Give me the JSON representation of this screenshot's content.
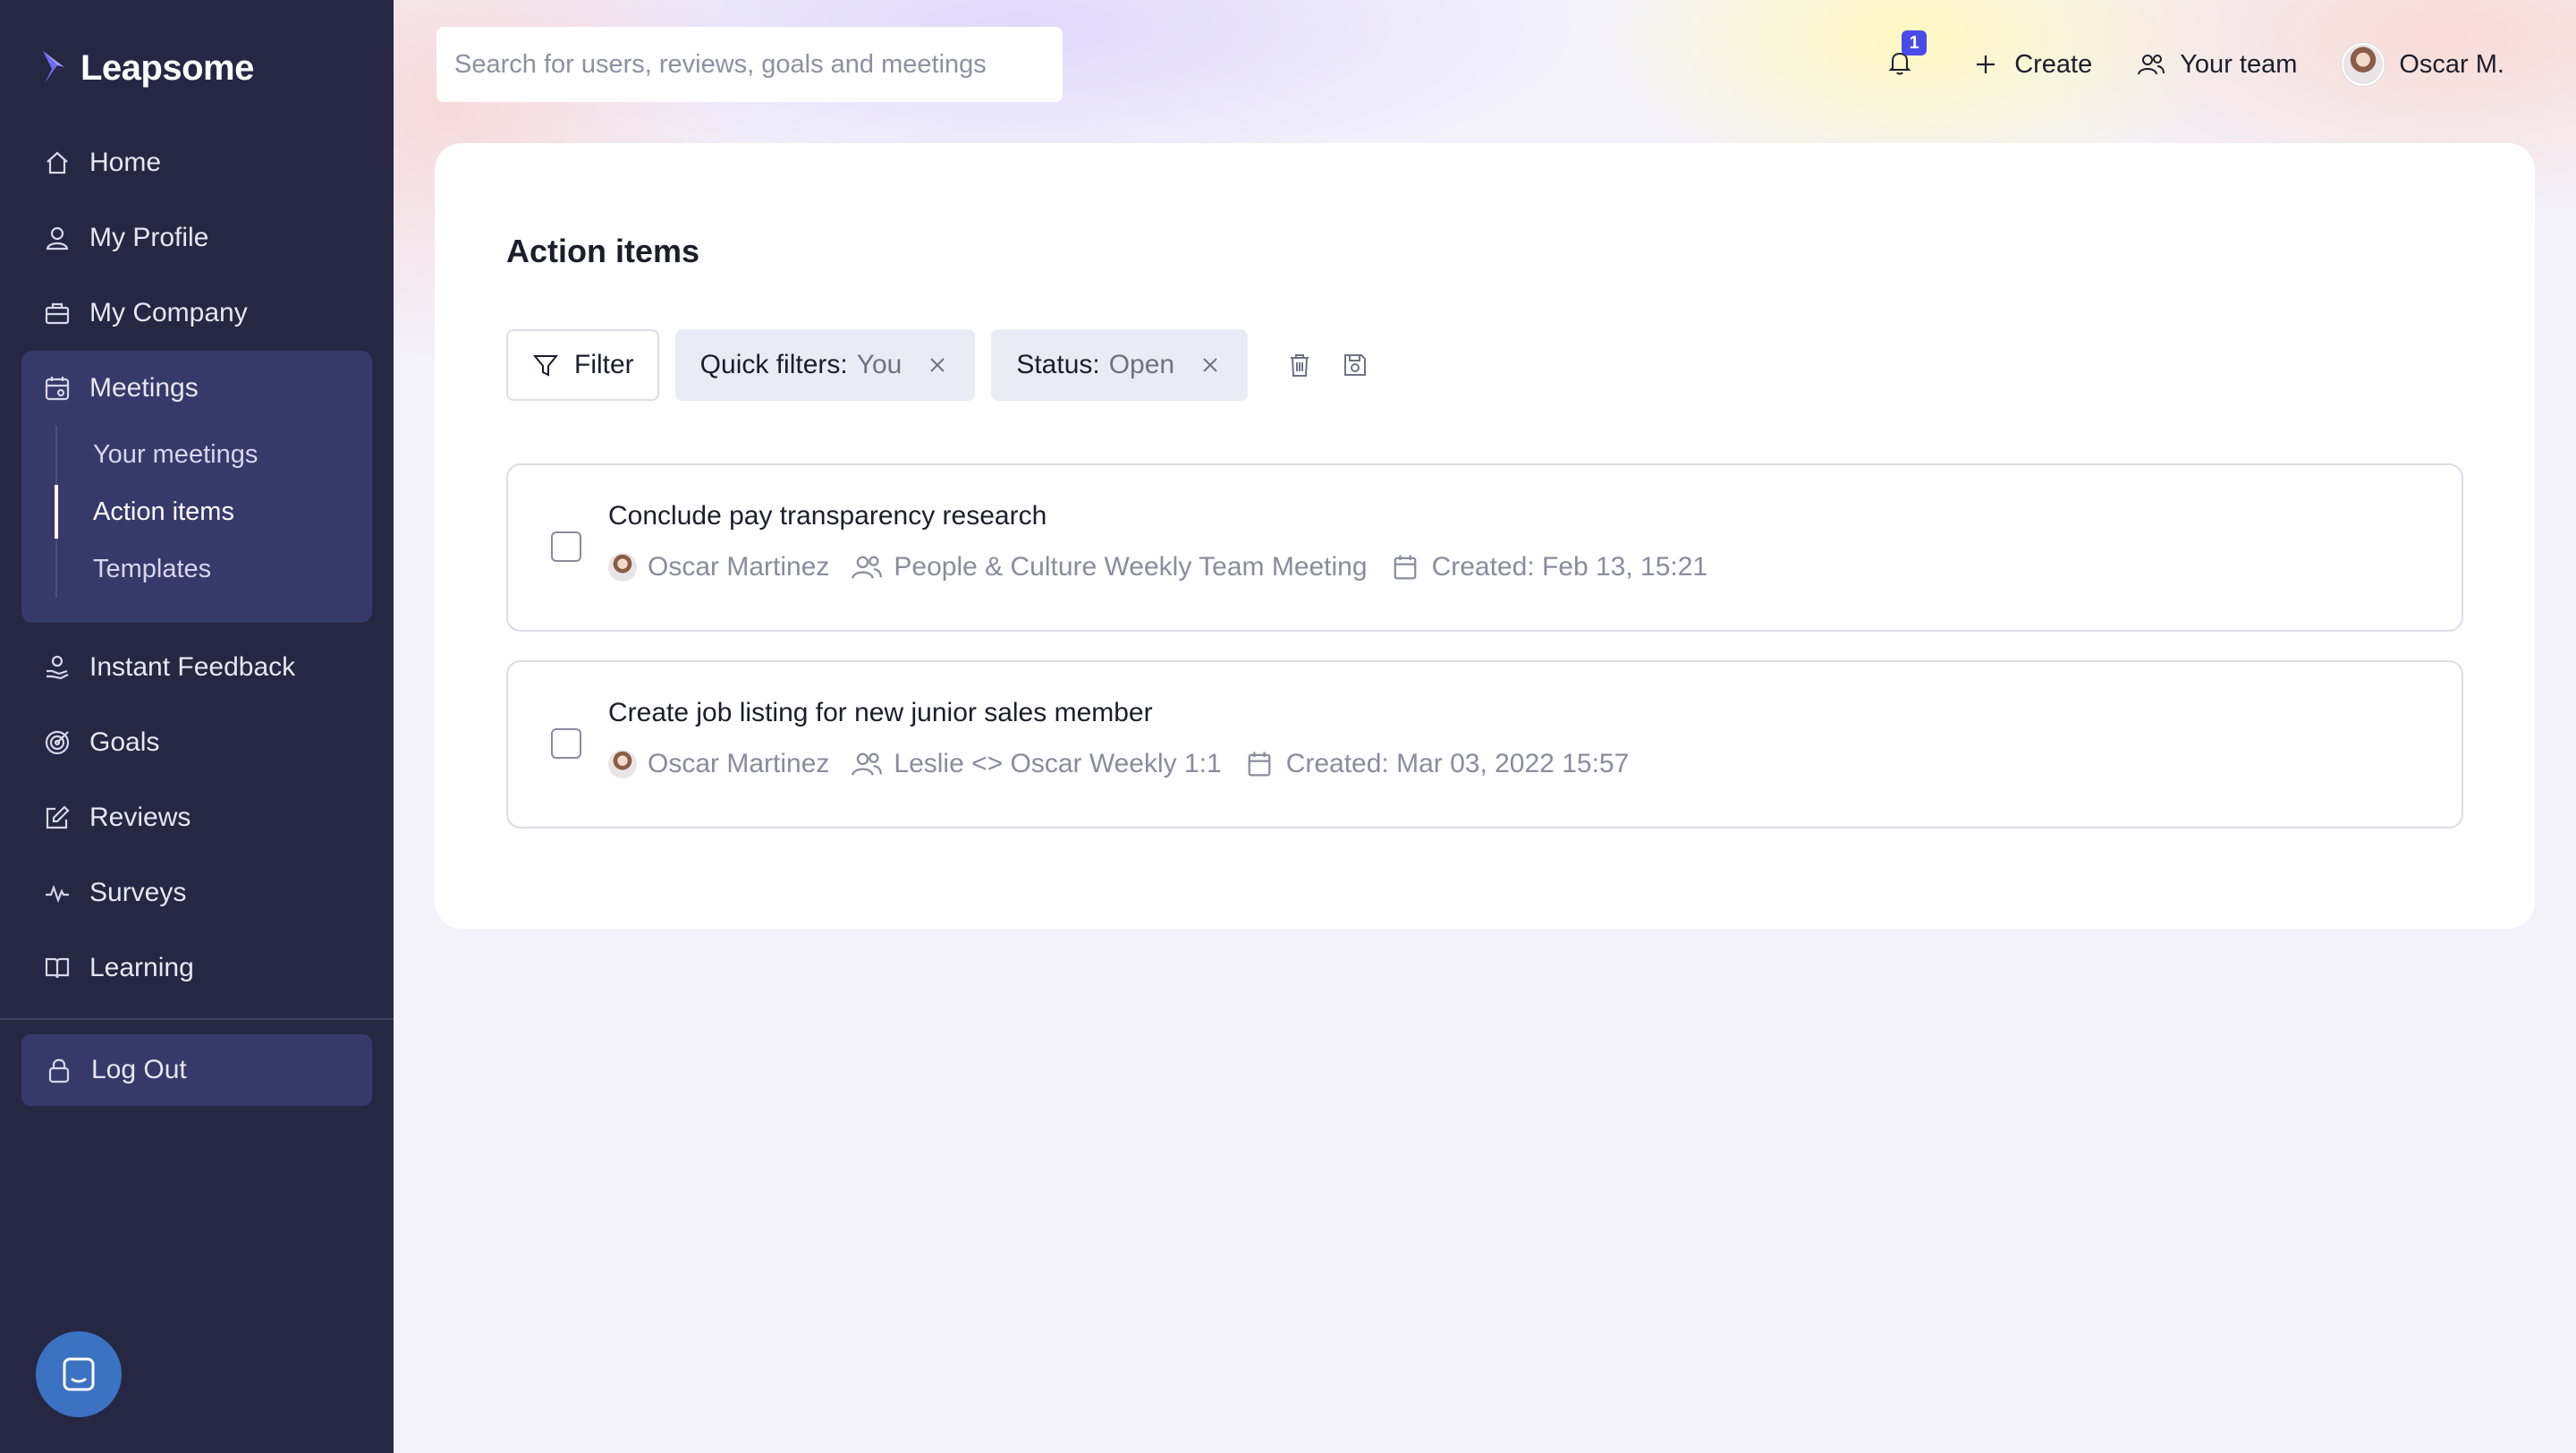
{
  "app": {
    "brand": "Leapsome"
  },
  "sidebar": {
    "items": [
      {
        "label": "Home",
        "icon": "home-icon"
      },
      {
        "label": "My Profile",
        "icon": "user-icon"
      },
      {
        "label": "My Company",
        "icon": "briefcase-icon"
      }
    ],
    "meetings": {
      "label": "Meetings",
      "icon": "calendar-icon",
      "sub": [
        {
          "label": "Your meetings",
          "active": false
        },
        {
          "label": "Action items",
          "active": true
        },
        {
          "label": "Templates",
          "active": false
        }
      ]
    },
    "items_after": [
      {
        "label": "Instant Feedback",
        "icon": "feedback-hand-icon"
      },
      {
        "label": "Goals",
        "icon": "target-icon"
      },
      {
        "label": "Reviews",
        "icon": "edit-icon"
      },
      {
        "label": "Surveys",
        "icon": "pulse-icon"
      },
      {
        "label": "Learning",
        "icon": "book-icon"
      }
    ],
    "logout": "Log Out"
  },
  "topbar": {
    "search_placeholder": "Search for users, reviews, goals and meetings",
    "notification_count": "1",
    "create_label": "Create",
    "team_label": "Your team",
    "user_label": "Oscar M."
  },
  "page": {
    "title": "Action items",
    "filter_label": "Filter",
    "chips": [
      {
        "key": "Quick filters:",
        "value": "You"
      },
      {
        "key": "Status:",
        "value": "Open"
      }
    ]
  },
  "action_items": [
    {
      "title": "Conclude pay transparency research",
      "owner": "Oscar Martinez",
      "meeting": "People & Culture Weekly Team Meeting",
      "created": "Created: Feb 13, 15:21"
    },
    {
      "title": "Create job listing for new junior sales member",
      "owner": "Oscar Martinez",
      "meeting": "Leslie <> Oscar Weekly 1:1",
      "created": "Created: Mar 03, 2022 15:57"
    }
  ],
  "colors": {
    "sidebar_bg": "#252743",
    "sidebar_active_bg": "#363a6b",
    "notification_badge": "#4a4ae8",
    "chat_button": "#3b72c2"
  }
}
